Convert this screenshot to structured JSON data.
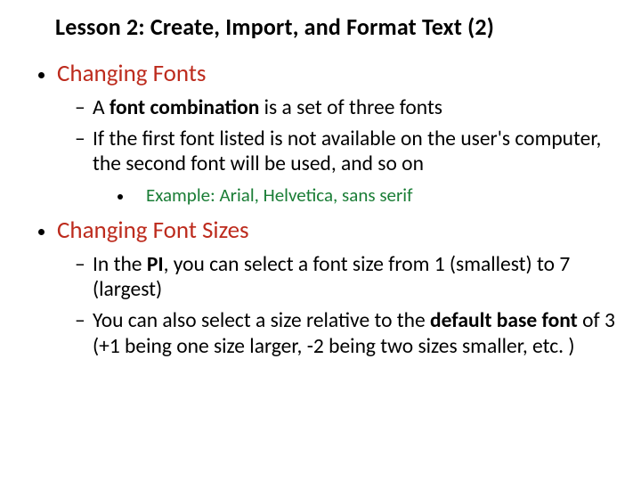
{
  "title": "Lesson 2: Create, Import, and Format Text (2)",
  "sections": [
    {
      "heading": "Changing Fonts",
      "sub": [
        {
          "pre": "A ",
          "bold": "font combination",
          "post": " is a set of three fonts"
        },
        {
          "pre": "If the first font listed is not available on the user's computer, the second font will be used, and so on",
          "bold": "",
          "post": ""
        }
      ],
      "example": "Example: Arial, Helvetica, sans serif"
    },
    {
      "heading": "Changing Font Sizes",
      "sub": [
        {
          "pre": "In the ",
          "bold": "PI",
          "post": ", you can select a font size from 1 (smallest) to 7 (largest)"
        },
        {
          "pre": "You can also select a size relative to the ",
          "bold": "default base font",
          "post": " of 3 (+1 being one size larger, -2 being two sizes smaller, etc. )"
        }
      ]
    }
  ]
}
